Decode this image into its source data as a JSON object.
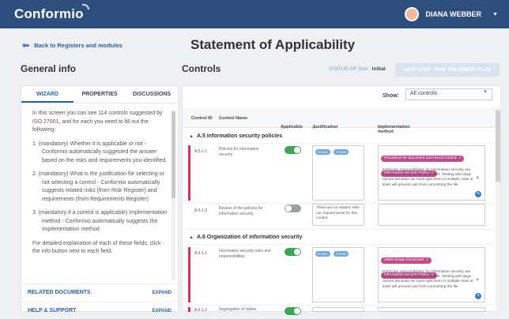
{
  "topbar": {
    "logo": "Conformio",
    "user_name": "DIANA WEBBER",
    "caret": "▼"
  },
  "nav": {
    "back_label": "Back to Registers and modules",
    "back_arrow": "⬅"
  },
  "page_title": "Statement of Applicability",
  "general_info": {
    "heading": "General info",
    "tabs": [
      {
        "label": "WIZARD"
      },
      {
        "label": "PROPERTIES"
      },
      {
        "label": "DISCUSSIONS"
      }
    ],
    "wizard_paragraphs": [
      "In this screen you can see 114 controls suggested by ISO 27001, and for each you need to fill out the following:",
      "1. (mandatory) Whether it is applicable or not - Conformio automatically suggested the answer based on the risks and requirements you identified.",
      "2. (mandatory) What is the justification for selecting or not selecting a control - Conformio automatically suggests related risks (from Risk Register) and requirements (from Requirements Register)",
      "3. (mandatory if a control is applicable) Implementation method - Conformio automatically suggests the implementation method",
      "For detailed explanation of each of these fields, click the info button next to each field."
    ],
    "related_documents": "RELATED DOCUMENTS",
    "help_support": "HELP & SUPPORT",
    "expand": "EXPAND"
  },
  "controls": {
    "heading": "Controls",
    "status_label": "STATUS OF SoA :",
    "status_value": "Initial",
    "next_step": "NEXT STEP - RISK TREATMENT PLAN",
    "show_label": "Show:",
    "show_value": "All controls",
    "columns": {
      "id": "Control ID",
      "name": "Control Name",
      "applicable": "Applicable",
      "justification": "Justification",
      "implementation": "Implementation method",
      "info_icon": "ⓘ"
    },
    "sections": [
      {
        "title": "A.5 Information security policies",
        "rows": [
          {
            "id": "A.5.1.1",
            "name": "Policies for information security",
            "applicable": true,
            "tags": [
              "R-0001",
              "R-0006"
            ],
            "justification_text": "",
            "impl_tags": [
              "Procedure for document and record control",
              "Information Security Policy"
            ],
            "impl_text": "Particular responsibilities for information security are specified in every ISMS document. Testing with large names because we must split them in multiple rows or linter will prevent use from committing the file"
          },
          {
            "id": "A.5.1.2",
            "name": "Review of the policies for information security",
            "applicable": false,
            "tags": [],
            "justification_text": "There are no related risks nor requirements for this control",
            "impl_tags": [],
            "impl_text": ""
          }
        ]
      },
      {
        "title": "A.6 Organization of information security",
        "rows": [
          {
            "id": "A.6.1.1",
            "name": "Information security roles and responsibilities",
            "applicable": true,
            "tags": [
              "R-0001",
              "R-0004"
            ],
            "justification_text": "",
            "impl_tags": [
              "ISMS Scope Document",
              "Information Security Policy"
            ],
            "impl_text": "Particular responsibilities for information security are specified in every ISMS document. Testing with large names because we must split them in multiple rows or linter will prevent use from committing the file"
          },
          {
            "id": "A.6.1.2",
            "name": "Segregation of duties",
            "applicable": true,
            "tags": [],
            "justification_text": "",
            "impl_tags": [],
            "impl_text": ""
          }
        ]
      }
    ],
    "close_x": "×",
    "add_icon": "+"
  },
  "colors": {
    "topbar": "#2e4e7e",
    "accent": "#2c5fa8",
    "toggle_on": "#3aa656",
    "flag": "#d6324d",
    "impl_tag": "#c44a8e",
    "risk_tag": "#6fa8dc"
  }
}
